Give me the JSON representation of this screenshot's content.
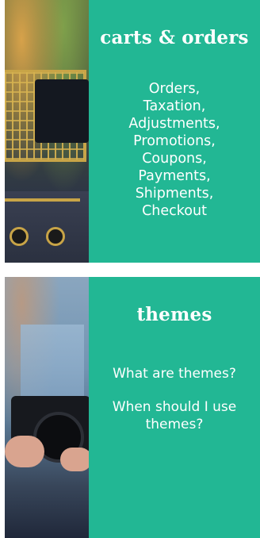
{
  "cards": [
    {
      "title": "carts & orders",
      "items": [
        "Orders,",
        "Taxation,",
        "Adjustments,",
        "Promotions,",
        "Coupons,",
        "Payments,",
        "Shipments,",
        "Checkout"
      ]
    },
    {
      "title": "themes",
      "questions": [
        "What are themes?",
        "When should I use themes?"
      ]
    }
  ],
  "colors": {
    "panel_bg": "#22b794",
    "panel_text": "#ffffff"
  }
}
